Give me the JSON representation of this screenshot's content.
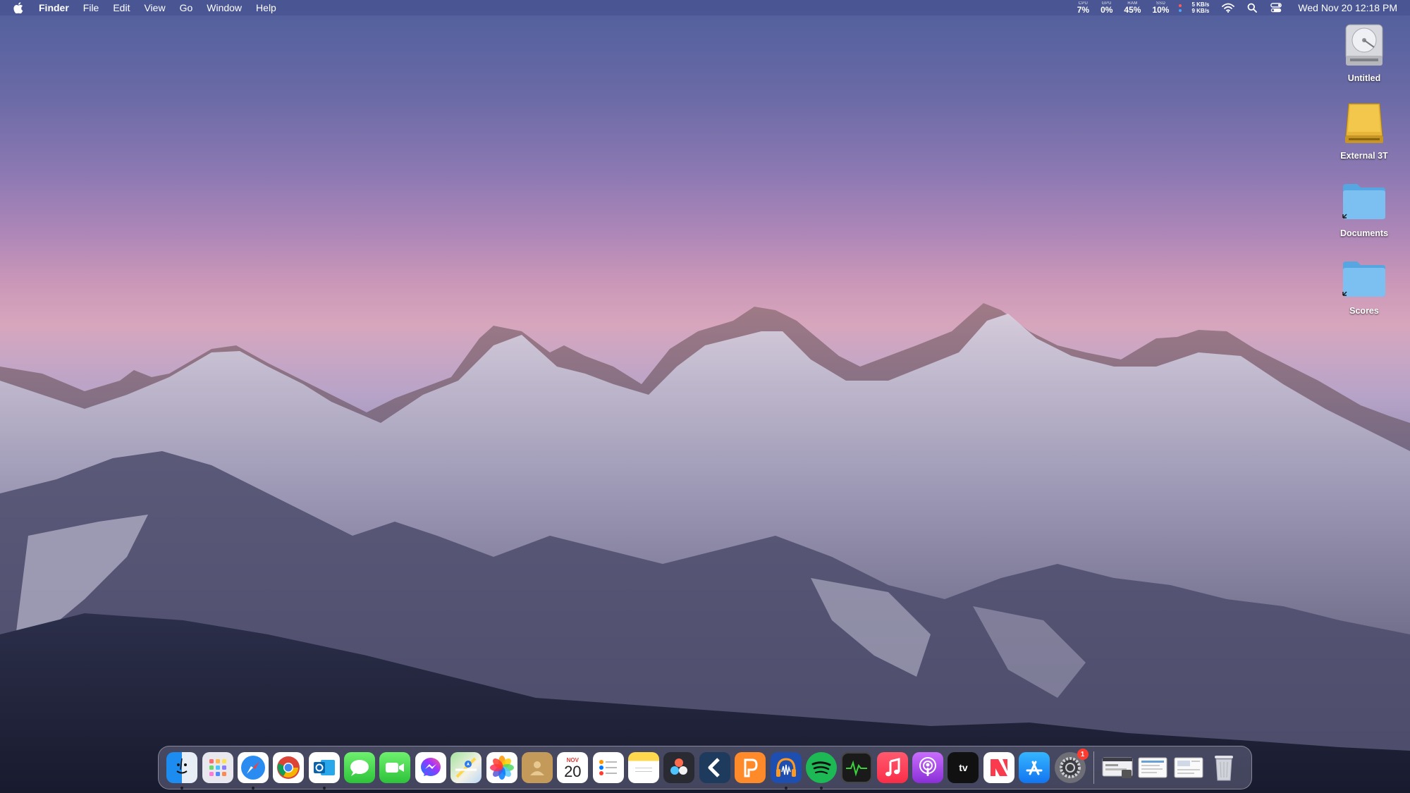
{
  "menubar": {
    "app_name": "Finder",
    "menus": [
      "File",
      "Edit",
      "View",
      "Go",
      "Window",
      "Help"
    ],
    "stats": [
      {
        "label": "CPU",
        "value": "7%"
      },
      {
        "label": "GPU",
        "value": "0%"
      },
      {
        "label": "RAM",
        "value": "45%"
      },
      {
        "label": "SSD",
        "value": "10%"
      }
    ],
    "net_up": "5 KB/s",
    "net_down": "9 KB/s",
    "clock": "Wed Nov 20  12:18 PM",
    "status_colors": {
      "dot_top": "#ff5b5b",
      "dot_bottom": "#4da3ff"
    }
  },
  "desktop": {
    "items": [
      {
        "label": "Untitled",
        "icon": "hard-drive-icon"
      },
      {
        "label": "External 3T",
        "icon": "external-drive-icon"
      },
      {
        "label": "Documents",
        "icon": "folder-alias-icon"
      },
      {
        "label": "Scores",
        "icon": "folder-alias-icon"
      }
    ]
  },
  "dock": {
    "apps": [
      {
        "name": "Finder",
        "icon": "finder-icon",
        "running": true
      },
      {
        "name": "Launchpad",
        "icon": "launchpad-icon",
        "running": false
      },
      {
        "name": "Safari",
        "icon": "safari-icon",
        "running": true
      },
      {
        "name": "Google Chrome",
        "icon": "chrome-icon",
        "running": false
      },
      {
        "name": "Microsoft Outlook",
        "icon": "outlook-icon",
        "running": true
      },
      {
        "name": "Messages",
        "icon": "messages-icon",
        "running": false
      },
      {
        "name": "FaceTime",
        "icon": "facetime-icon",
        "running": false
      },
      {
        "name": "Messenger",
        "icon": "messenger-icon",
        "running": false
      },
      {
        "name": "Maps",
        "icon": "maps-icon",
        "running": false
      },
      {
        "name": "Photos",
        "icon": "photos-icon",
        "running": false
      },
      {
        "name": "Contacts",
        "icon": "contacts-icon",
        "running": false
      },
      {
        "name": "Calendar",
        "icon": "calendar-icon",
        "running": false
      },
      {
        "name": "Reminders",
        "icon": "reminders-icon",
        "running": false
      },
      {
        "name": "Notes",
        "icon": "notes-icon",
        "running": false
      },
      {
        "name": "DaVinci Resolve",
        "icon": "davinci-icon",
        "running": false
      },
      {
        "name": "Back",
        "icon": "chevron-app-icon",
        "running": false
      },
      {
        "name": "Pages",
        "icon": "pages-icon",
        "running": false
      },
      {
        "name": "Audacity",
        "icon": "audacity-icon",
        "running": true
      },
      {
        "name": "Spotify",
        "icon": "spotify-icon",
        "running": true
      },
      {
        "name": "Activity Monitor",
        "icon": "activity-monitor-icon",
        "running": false
      },
      {
        "name": "Music",
        "icon": "music-icon",
        "running": false
      },
      {
        "name": "Podcasts",
        "icon": "podcasts-icon",
        "running": false
      },
      {
        "name": "Apple TV",
        "icon": "apple-tv-icon",
        "running": false
      },
      {
        "name": "News",
        "icon": "news-icon",
        "running": false
      },
      {
        "name": "App Store",
        "icon": "app-store-icon",
        "running": false
      },
      {
        "name": "System Settings",
        "icon": "system-settings-icon",
        "running": false,
        "badge": "1"
      }
    ],
    "calendar_month": "NOV",
    "calendar_day": "20",
    "tv_label": "tv",
    "system_settings_badge": "1",
    "recent": [
      "window-preview-icon",
      "document-preview-icon",
      "document-preview-icon"
    ],
    "trash": "trash-icon"
  }
}
